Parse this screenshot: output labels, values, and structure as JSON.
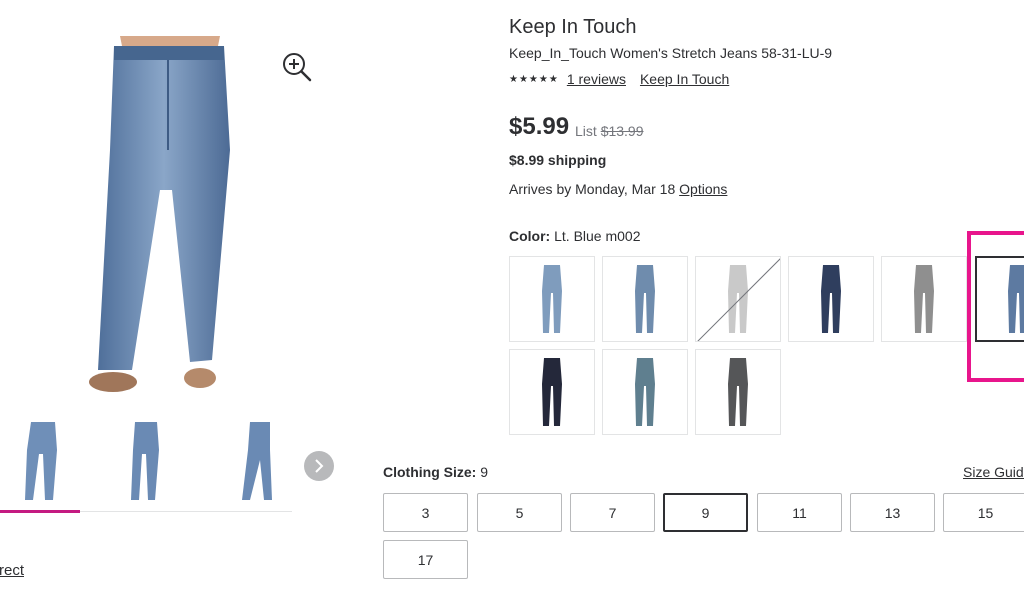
{
  "gallery": {
    "main_image_alt": "jeans-main-photo",
    "zoom_icon": "zoom-in-icon",
    "next_icon": "chevron-right-icon",
    "report_link": "rrect"
  },
  "product": {
    "brand": "Keep In Touch",
    "name": "Keep_In_Touch Women's Stretch Jeans 58-31-LU-9",
    "stars": "★★★★★",
    "reviews": "1 reviews",
    "brand_link": "Keep In Touch",
    "price": "$5.99",
    "list_label": "List",
    "list_price": "$13.99",
    "shipping": "$8.99 shipping",
    "arrives": "Arrives by Monday, Mar 18",
    "options_link": "Options"
  },
  "color": {
    "label": "Color:",
    "value": "Lt. Blue m002",
    "swatches": [
      {
        "name": "light-wash",
        "color": "#7f9cbd",
        "unavailable": false,
        "selected": false
      },
      {
        "name": "ripped-wash",
        "color": "#6f8cad",
        "unavailable": false,
        "selected": false
      },
      {
        "name": "light-grey",
        "color": "#c9c9c9",
        "unavailable": true,
        "selected": false
      },
      {
        "name": "dark-blue",
        "color": "#2f3e5e",
        "unavailable": false,
        "selected": false
      },
      {
        "name": "grey-wash",
        "color": "#8f8f8f",
        "unavailable": false,
        "selected": false
      },
      {
        "name": "lt-blue-m002",
        "color": "#5d7aa1",
        "unavailable": false,
        "selected": true
      },
      {
        "name": "black-denim",
        "color": "#24283a",
        "unavailable": false,
        "selected": false
      },
      {
        "name": "teal-wash",
        "color": "#5f7f8f",
        "unavailable": false,
        "selected": false
      },
      {
        "name": "charcoal",
        "color": "#555658",
        "unavailable": false,
        "selected": false
      }
    ]
  },
  "size": {
    "label": "Clothing Size:",
    "value": "9",
    "guide_link": "Size Guide",
    "options": [
      "3",
      "5",
      "7",
      "9",
      "11",
      "13",
      "15",
      "17"
    ],
    "selected": "9"
  },
  "colors": {
    "accent": "#c41a81",
    "highlight": "#e8158c",
    "denim": "#5b7aa6",
    "text": "#2e2f32"
  }
}
